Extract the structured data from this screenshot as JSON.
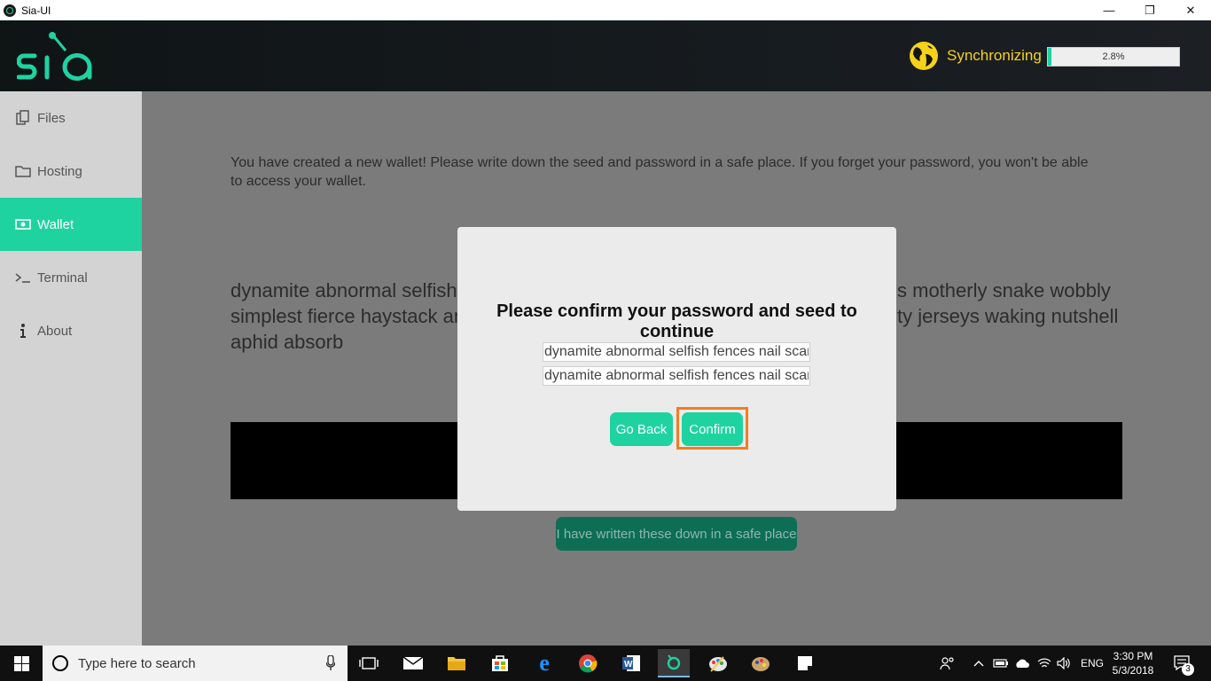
{
  "window": {
    "title": "Sia-UI",
    "minimize": "—",
    "restore": "❐",
    "close": "✕"
  },
  "header": {
    "sync_label": "Synchronizing",
    "progress_text": "2.8%",
    "progress_fraction": 0.028,
    "accent_color": "#1ed3a0",
    "sync_color": "#f5d21a"
  },
  "sidebar": {
    "items": [
      {
        "label": "Files",
        "icon": "files-icon"
      },
      {
        "label": "Hosting",
        "icon": "folder-icon"
      },
      {
        "label": "Wallet",
        "icon": "wallet-icon"
      },
      {
        "label": "Terminal",
        "icon": "terminal-icon"
      },
      {
        "label": "About",
        "icon": "info-icon"
      }
    ],
    "active": "Wallet"
  },
  "main": {
    "intro_text": "You have created a new wallet! Please write down the seed and password in a safe place. If you forget your password, you won't be able to access your wallet.",
    "seed_line1_left": "dynamite abnormal selfish f",
    "seed_line1_right": "s motherly snake wobbly",
    "seed_line2_left": "simplest fierce haystack am",
    "seed_line2_right": "ty jerseys waking nutshell",
    "seed_line3": "aphid absorb",
    "written_button": "I have written these down in a safe place"
  },
  "modal": {
    "title": "Please confirm your password and seed to continue",
    "password_value": "dynamite abnormal selfish fences nail scam",
    "seed_value": "dynamite abnormal selfish fences nail scam",
    "go_back_label": "Go Back",
    "confirm_label": "Confirm",
    "highlight_color": "#f47d20"
  },
  "taskbar": {
    "search_placeholder": "Type here to search",
    "language": "ENG",
    "time": "3:30 PM",
    "date": "5/3/2018",
    "notification_count": "3"
  }
}
